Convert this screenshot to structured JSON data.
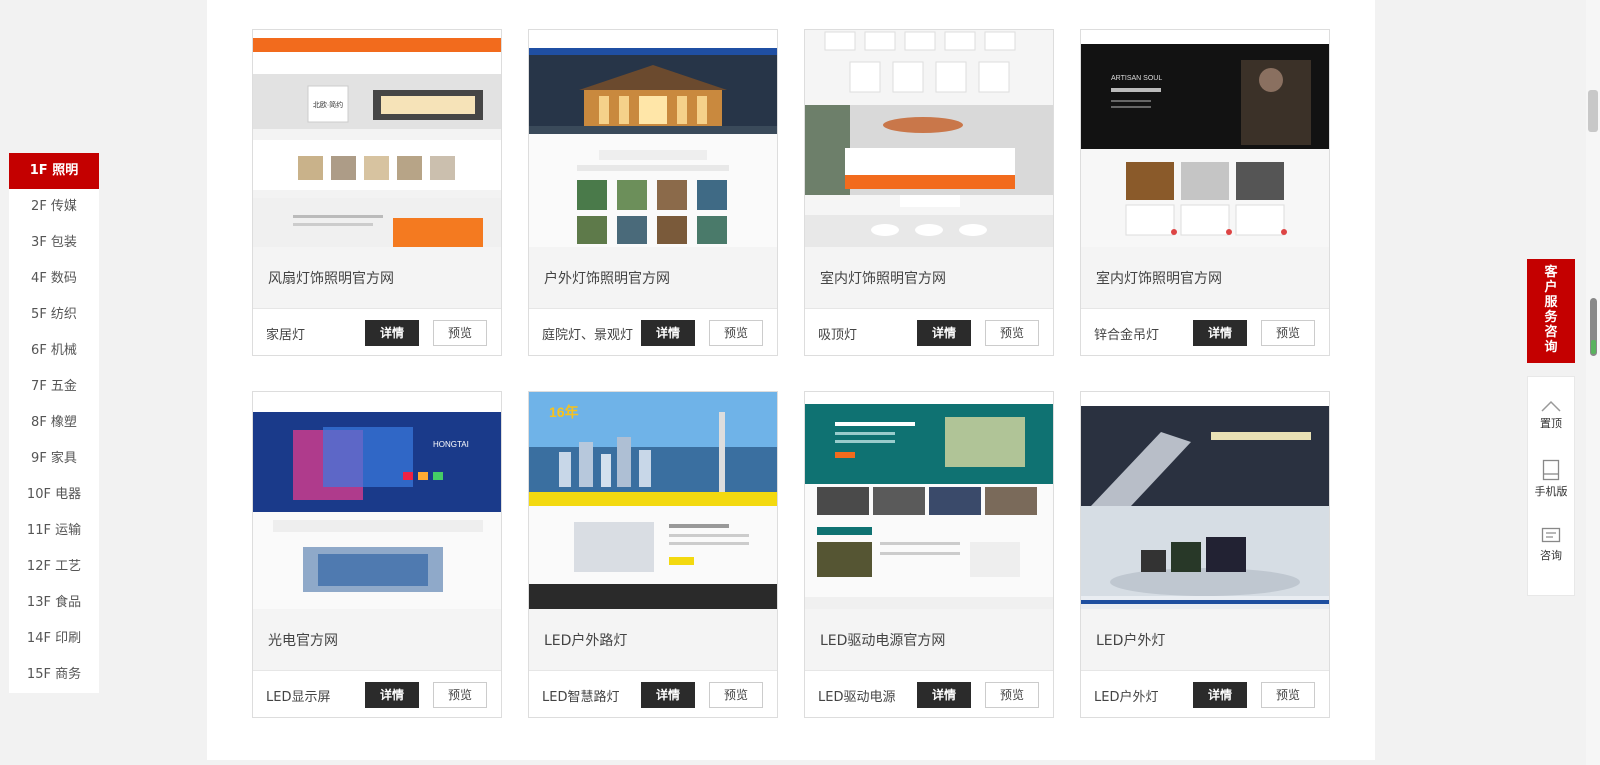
{
  "floors": [
    {
      "label": "1F 照明",
      "active": true
    },
    {
      "label": "2F 传媒"
    },
    {
      "label": "3F 包装"
    },
    {
      "label": "4F 数码"
    },
    {
      "label": "5F 纺织"
    },
    {
      "label": "6F 机械"
    },
    {
      "label": "7F 五金"
    },
    {
      "label": "8F 橡塑"
    },
    {
      "label": "9F 家具"
    },
    {
      "label": "10F 电器"
    },
    {
      "label": "11F 运输"
    },
    {
      "label": "12F 工艺"
    },
    {
      "label": "13F 食品"
    },
    {
      "label": "14F 印刷"
    },
    {
      "label": "15F 商务"
    }
  ],
  "buttons": {
    "detail": "详情",
    "preview": "预览"
  },
  "cards": [
    {
      "title": "风扇灯饰照明官方网",
      "category": "家居灯",
      "thumb_style": "orange-header",
      "thumb_text": "北欧·简约"
    },
    {
      "title": "户外灯饰照明官方网",
      "category": "庭院灯、景观灯",
      "thumb_style": "night-building",
      "thumb_text": ""
    },
    {
      "title": "室内灯饰照明官方网",
      "category": "吸顶灯",
      "thumb_style": "ceiling-lamps",
      "thumb_text": ""
    },
    {
      "title": "室内灯饰照明官方网",
      "category": "锌合金吊灯",
      "thumb_style": "dark-craft",
      "thumb_text": "ARTISAN SOUL"
    },
    {
      "title": "光电官方网",
      "category": "LED显示屏",
      "thumb_style": "blue-screen",
      "thumb_text": "HONGTAI"
    },
    {
      "title": "LED户外路灯",
      "category": "LED智慧路灯",
      "thumb_style": "city-sky",
      "thumb_text": "16年"
    },
    {
      "title": "LED驱动电源官方网",
      "category": "LED驱动电源",
      "thumb_style": "teal-power",
      "thumb_text": ""
    },
    {
      "title": "LED户外灯",
      "category": "LED户外灯",
      "thumb_style": "night-road",
      "thumb_text": ""
    }
  ],
  "side_panel": {
    "service_chars": [
      "客",
      "户",
      "服",
      "务",
      "咨",
      "询"
    ],
    "tools": [
      {
        "label": "置顶",
        "icon": "chevron-up-icon"
      },
      {
        "label": "手机版",
        "icon": "mobile-icon"
      },
      {
        "label": "咨询",
        "icon": "message-icon"
      }
    ]
  }
}
